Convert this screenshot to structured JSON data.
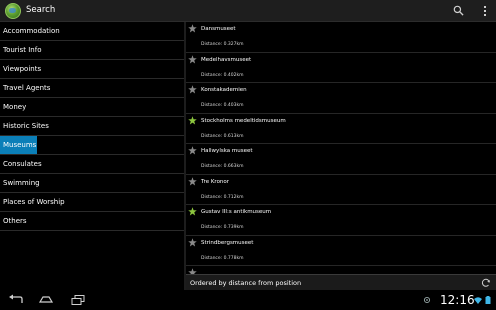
{
  "action_bar": {
    "title": "Search",
    "app_icon": "globe-icon",
    "search_icon": "search-icon",
    "overflow_icon": "overflow-menu-icon"
  },
  "categories": [
    {
      "label": "Accommodation",
      "selected": false
    },
    {
      "label": "Tourist Info",
      "selected": false
    },
    {
      "label": "Viewpoints",
      "selected": false
    },
    {
      "label": "Travel Agents",
      "selected": false
    },
    {
      "label": "Money",
      "selected": false
    },
    {
      "label": "Historic Sites",
      "selected": false
    },
    {
      "label": "Museums",
      "selected": true
    },
    {
      "label": "Consulates",
      "selected": false
    },
    {
      "label": "Swimming",
      "selected": false
    },
    {
      "label": "Places of Worship",
      "selected": false
    },
    {
      "label": "Others",
      "selected": false
    }
  ],
  "museums": [
    {
      "name": "Dansmuseet",
      "distance": "Distance: 0.327km",
      "favorite": false
    },
    {
      "name": "Medelhavsmuseet",
      "distance": "Distance: 0.402km",
      "favorite": false
    },
    {
      "name": "Konstakademien",
      "distance": "Distance: 0.403km",
      "favorite": false
    },
    {
      "name": "Stockholms medeltidsmuseum",
      "distance": "Distance: 0.613km",
      "favorite": true
    },
    {
      "name": "Hallwylska museet",
      "distance": "Distance: 0.663km",
      "favorite": false
    },
    {
      "name": "Tre Kronor",
      "distance": "Distance: 0.712km",
      "favorite": false
    },
    {
      "name": "Gustav III:s antikmuseum",
      "distance": "Distance: 0.739km",
      "favorite": true
    },
    {
      "name": "Strindbergsmuseet",
      "distance": "Distance: 0.778km",
      "favorite": false
    },
    {
      "name": "",
      "distance": "",
      "favorite": false
    }
  ],
  "order_bar": {
    "label": "Ordered by distance from position",
    "refresh_icon": "refresh-icon"
  },
  "system_bar": {
    "time": "12:16",
    "back_icon": "back-icon",
    "home_icon": "home-icon",
    "recents_icon": "recent-apps-icon",
    "location_icon": "gps-icon",
    "wifi_icon": "wifi-icon",
    "battery_icon": "battery-icon"
  },
  "colors": {
    "selected": "#0b7fb8",
    "star_favorite": "#8dc63f",
    "star_default": "#8a8a8a"
  }
}
